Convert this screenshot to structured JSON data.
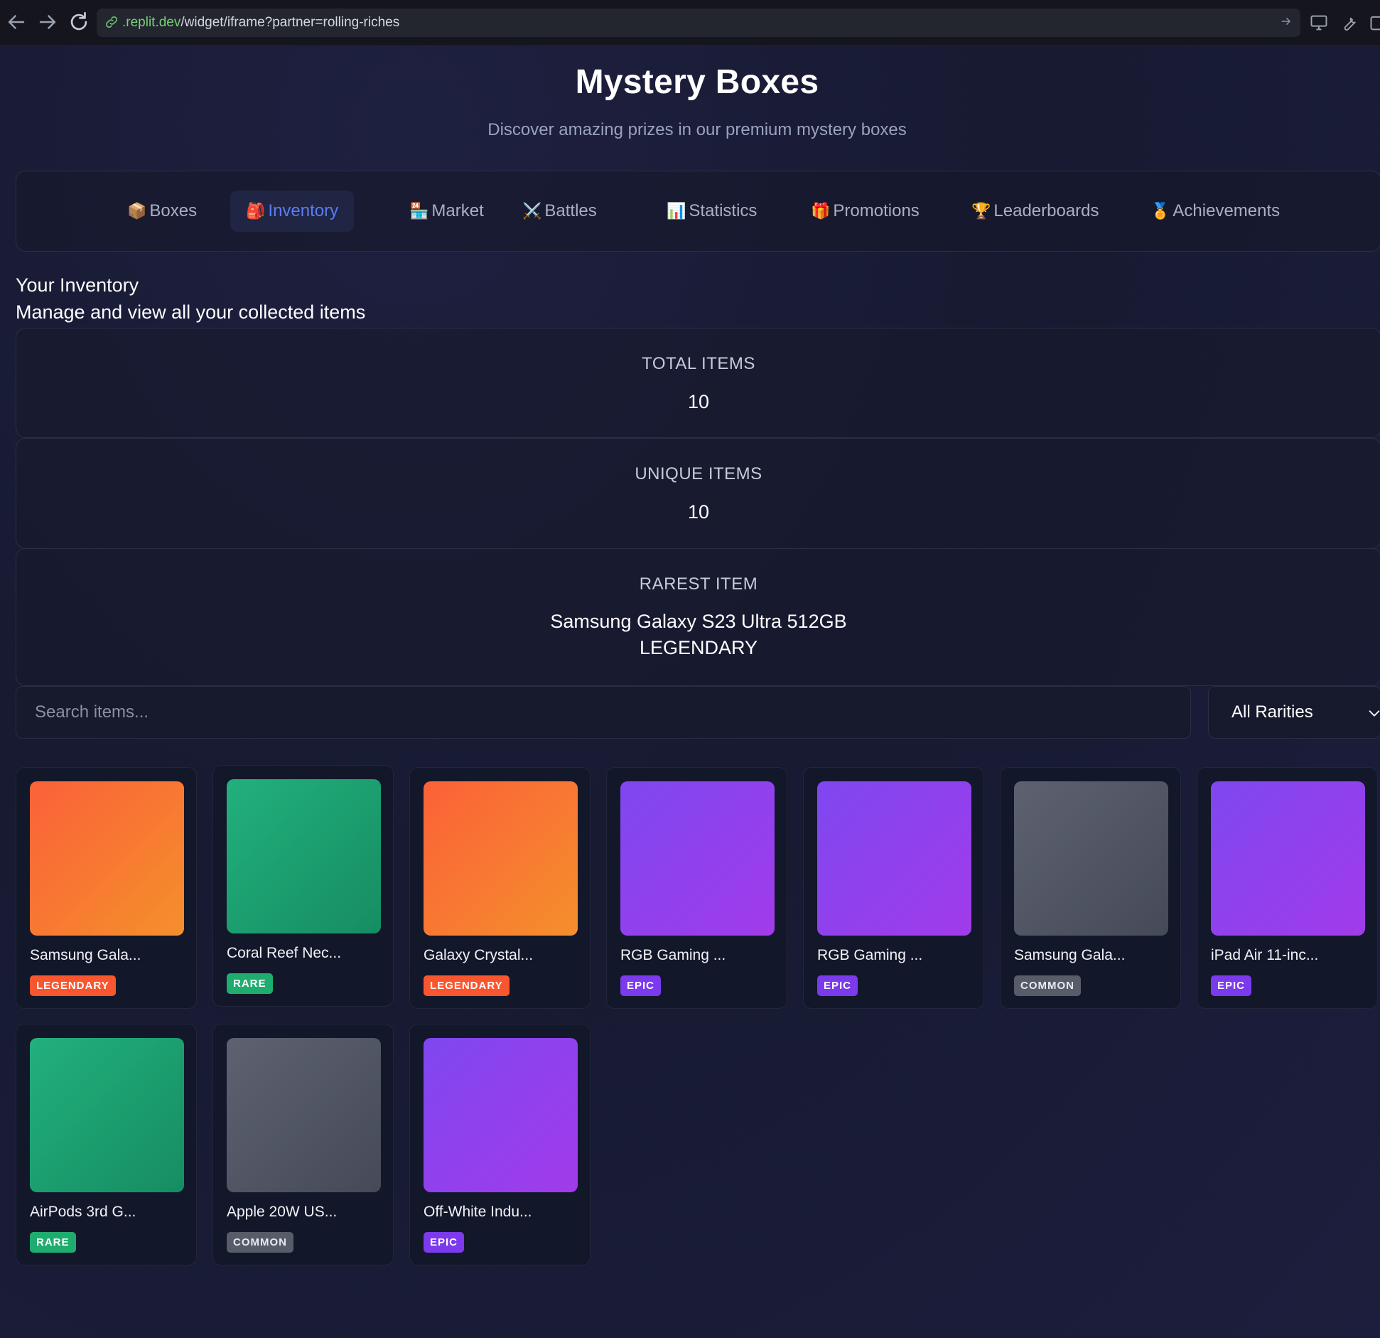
{
  "browser": {
    "url_host": ".replit.dev",
    "url_path": "/widget/iframe?partner=rolling-riches"
  },
  "header": {
    "title": "Mystery Boxes",
    "subtitle": "Discover amazing prizes in our premium mystery boxes"
  },
  "tabs": [
    {
      "icon": "📦",
      "label": "Boxes"
    },
    {
      "icon": "🎒",
      "label": "Inventory",
      "active": true
    },
    {
      "icon": "🏪",
      "label": "Market"
    },
    {
      "icon": "⚔️",
      "label": "Battles"
    },
    {
      "icon": "📊",
      "label": "Statistics"
    },
    {
      "icon": "🎁",
      "label": "Promotions"
    },
    {
      "icon": "🏆",
      "label": "Leaderboards"
    },
    {
      "icon": "🏅",
      "label": "Achievements"
    }
  ],
  "inventory": {
    "title": "Your Inventory",
    "subtitle": "Manage and view all your collected items"
  },
  "stats": {
    "total_label": "TOTAL ITEMS",
    "total_value": "10",
    "unique_label": "UNIQUE ITEMS",
    "unique_value": "10",
    "rarest_label": "RAREST ITEM",
    "rarest_name": "Samsung Galaxy S23 Ultra 512GB",
    "rarest_rarity": "LEGENDARY"
  },
  "search": {
    "placeholder": "Search items...",
    "value": ""
  },
  "filter": {
    "selected": "All Rarities"
  },
  "colors": {
    "legendary": "#f8562f",
    "rare": "#1fad6f",
    "epic": "#7c3aed",
    "common": "#575c69",
    "active_tab": "#5b7cf5"
  },
  "items": [
    {
      "name": "Samsung Gala...",
      "rarity": "LEGENDARY"
    },
    {
      "name": "Coral Reef Nec...",
      "rarity": "RARE"
    },
    {
      "name": "Galaxy Crystal...",
      "rarity": "LEGENDARY"
    },
    {
      "name": "RGB Gaming ...",
      "rarity": "EPIC"
    },
    {
      "name": "RGB Gaming ...",
      "rarity": "EPIC"
    },
    {
      "name": "Samsung Gala...",
      "rarity": "COMMON"
    },
    {
      "name": "iPad Air 11-inc...",
      "rarity": "EPIC"
    },
    {
      "name": "AirPods 3rd G...",
      "rarity": "RARE"
    },
    {
      "name": "Apple 20W US...",
      "rarity": "COMMON"
    },
    {
      "name": "Off-White Indu...",
      "rarity": "EPIC"
    }
  ]
}
